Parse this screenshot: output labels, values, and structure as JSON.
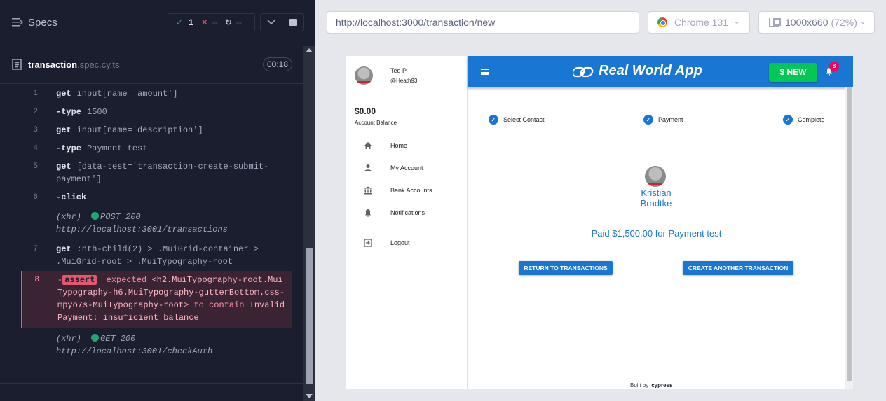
{
  "reporter": {
    "specs_label": "Specs",
    "stats": {
      "passed": "1",
      "failed": "--",
      "pending": "--",
      "pass_icon": "✓",
      "fail_icon": "✕",
      "pending_icon": "↻"
    },
    "file": {
      "name": "transaction",
      "ext": ".spec.cy.ts",
      "timer": "00:18"
    },
    "commands": [
      {
        "num": "1",
        "name": "get",
        "msg": "input[name='amount']"
      },
      {
        "num": "2",
        "name": "-type",
        "msg": "1500"
      },
      {
        "num": "3",
        "name": "get",
        "msg": "input[name='description']"
      },
      {
        "num": "4",
        "name": "-type",
        "msg": "Payment test"
      },
      {
        "num": "5",
        "name": "get",
        "msg": "[data-test='transaction-create-submit-payment']"
      },
      {
        "num": "6",
        "name": "-click",
        "msg": ""
      }
    ],
    "xhr1": {
      "type": "(xhr)",
      "status": "POST 200",
      "url": "http://localhost:3001/transactions"
    },
    "command7": {
      "num": "7",
      "name": "get",
      "msg": ":nth-child(2) > .MuiGrid-container > .MuiGrid-root > .MuiTypography-root"
    },
    "failed": {
      "num": "8",
      "dash": "-",
      "badge": "assert",
      "expected": "expected",
      "subject": "<h2.MuiTypography-root.MuiTypography-h6.MuiTypography-gutterBottom.css-mpyo7s-MuiTypography-root>",
      "to_contain": "to contain",
      "value": "Invalid Payment: insuficient balance"
    },
    "xhr2": {
      "type": "(xhr)",
      "status": "GET 200",
      "url": "http://localhost:3001/checkAuth"
    }
  },
  "preview": {
    "url": "http://localhost:3000/transaction/new",
    "browser": "Chrome 131",
    "viewport": "1000x660",
    "zoom": "(72%)"
  },
  "app": {
    "user": {
      "name": "Ted P",
      "handle": "@Heath93"
    },
    "balance": "$0.00",
    "balance_label": "Account Balance",
    "nav": [
      {
        "label": "Home",
        "icon": "home-icon"
      },
      {
        "label": "My Account",
        "icon": "person-icon"
      },
      {
        "label": "Bank Accounts",
        "icon": "bank-icon"
      },
      {
        "label": "Notifications",
        "icon": "bell-icon"
      },
      {
        "label": "Logout",
        "icon": "logout-icon"
      }
    ],
    "title": "Real World App",
    "new_button": "$ NEW",
    "notification_count": "8",
    "steps": [
      "Select Contact",
      "Payment",
      "Complete"
    ],
    "contact_name": "Kristian Bradtke",
    "paid_message": "Paid $1,500.00 for Payment test",
    "return_button": "RETURN TO TRANSACTIONS",
    "create_button": "CREATE ANOTHER TRANSACTION",
    "built_by": "Built by",
    "built_by_brand": "cypress"
  },
  "colors": {
    "accent": "#1976d2",
    "new_button": "#00c853",
    "reporter_bg": "#1b1e2e",
    "fail": "#e45770",
    "pass": "#1fa971"
  }
}
